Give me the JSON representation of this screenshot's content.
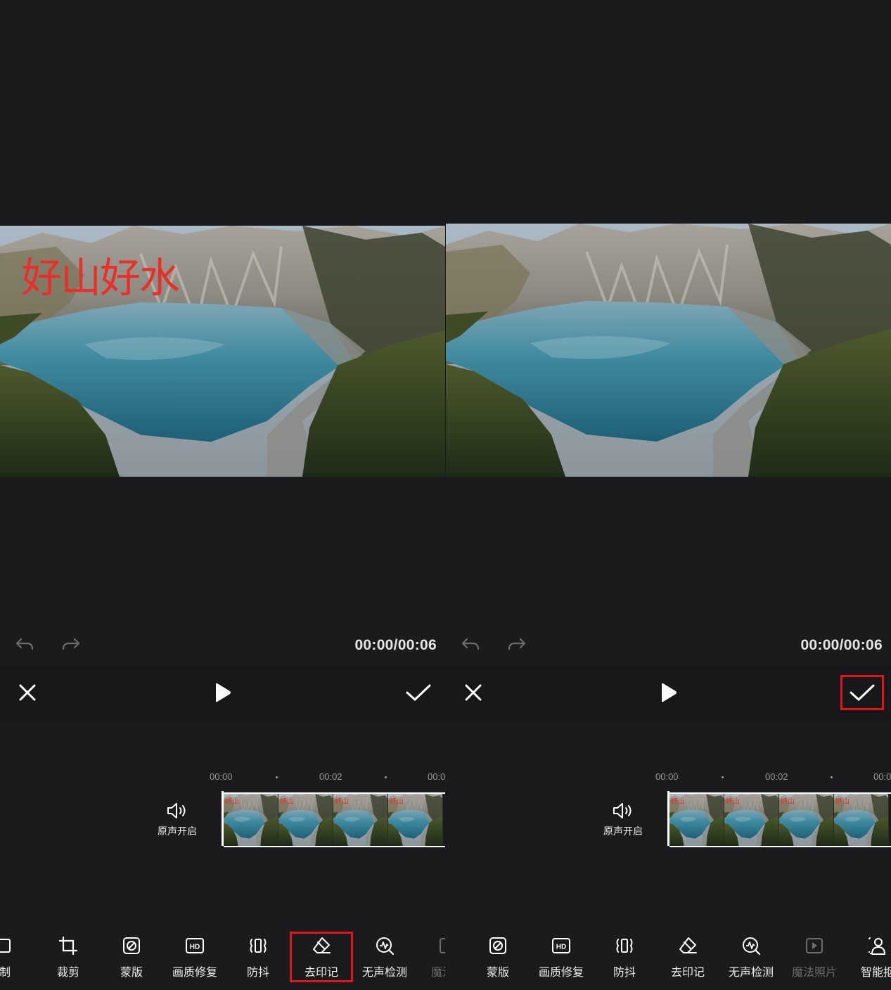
{
  "left": {
    "watermark_text": "好山好水",
    "timecode": "00:00/00:06",
    "ruler": [
      "00:00",
      "00:02",
      "00:0"
    ],
    "audio_label": "原声开启",
    "thumb_watermark": "好山",
    "tools": [
      "制",
      "裁剪",
      "蒙版",
      "画质修复",
      "防抖",
      "去印记",
      "无声检测",
      "魔法照"
    ]
  },
  "right": {
    "timecode": "00:00/00:06",
    "ruler": [
      "00:00",
      "00:02",
      "00:0"
    ],
    "audio_label": "原声开启",
    "thumb_watermark": "好山",
    "tools": [
      "蒙版",
      "画质修复",
      "防抖",
      "去印记",
      "无声检测",
      "魔法照片",
      "智能抠"
    ]
  },
  "highlight_color": "#e0161b",
  "watermark_color": "#e8302a"
}
